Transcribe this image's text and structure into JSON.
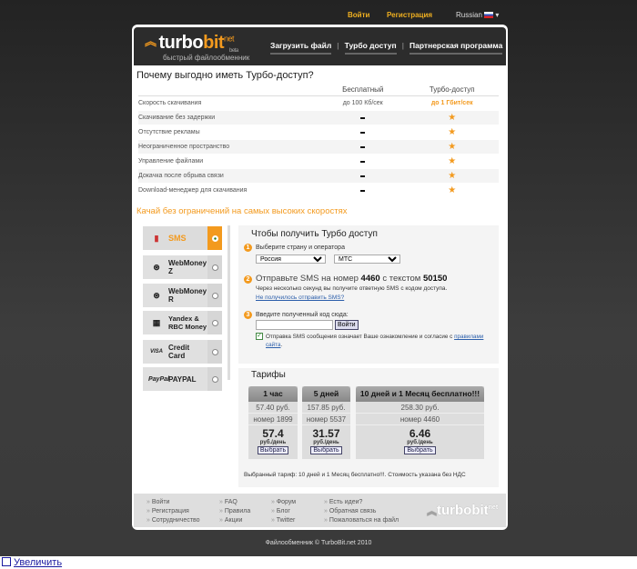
{
  "topbar": {
    "login": "Войти",
    "register": "Регистрация",
    "language": "Russian"
  },
  "header": {
    "logo_turbo": "turbo",
    "logo_bit": "bit",
    "logo_net": "net",
    "logo_beta": "beta",
    "tagline": "быстрый файлообменник",
    "nav": [
      "Загрузить файл",
      "Турбо доступ",
      "Партнерская программа"
    ]
  },
  "compare": {
    "title": "Почему выгодно иметь Турбо-доступ?",
    "col_free": "Бесплатный",
    "col_turbo": "Турбо-доступ",
    "rows": [
      {
        "label": "Скорость скачивания",
        "free": "до 100 Кб/сек",
        "turbo": "до 1 Гбит/сек"
      },
      {
        "label": "Скачивание без задержки"
      },
      {
        "label": "Отсутствие рекламы"
      },
      {
        "label": "Неограниченное пространство"
      },
      {
        "label": "Управление файлами"
      },
      {
        "label": "Докачка после обрыва связи"
      },
      {
        "label": "Download-менеджер для скачивания"
      }
    ]
  },
  "subtitle": "Качай без ограничений на самых высоких скоростях",
  "methods": [
    {
      "label": "SMS",
      "selected": true
    },
    {
      "label": "WebMoney Z"
    },
    {
      "label": "WebMoney R"
    },
    {
      "label": "Yandex & RBC Money"
    },
    {
      "label": "Credit Card"
    },
    {
      "label": "PAYPAL"
    }
  ],
  "sms": {
    "title": "Чтобы получить Турбо доступ",
    "step1": "Выберите страну и оператора",
    "country": "Россия",
    "operator": "МТС",
    "step2_pre": "Отправьте SMS на номер",
    "number": "4460",
    "step2_mid": "с текстом",
    "code": "50150",
    "step2_note": "Через несколько секунд вы получите ответную SMS с кодом доступа.",
    "step2_link": "Не получилось отправить SMS?",
    "step3": "Введите полученный код сюда:",
    "code_value": "",
    "login_button": "Войти",
    "agree_text": "Отправка SMS сообщения означает Ваше ознакомление и согласие с",
    "agree_link": "правилами сайта",
    "agree_end": "."
  },
  "tariffs": {
    "title": "Тарифы",
    "plans": [
      {
        "name": "1 час",
        "price": "57.40 руб.",
        "number": "номер 1899",
        "per_day": "57.4",
        "unit": "руб./день",
        "button": "Выбрать"
      },
      {
        "name": "5 дней",
        "price": "157.85 руб.",
        "number": "номер 5537",
        "per_day": "31.57",
        "unit": "руб./день",
        "button": "Выбрать"
      },
      {
        "name": "10 дней и 1 Месяц бесплатно!!!",
        "price": "258.30 руб.",
        "number": "номер 4460",
        "per_day": "6.46",
        "unit": "руб./день",
        "button": "Выбрать"
      }
    ],
    "selected_note": "Выбранный тариф: 10 дней и 1 Месяц бесплатно!!!. Стоимость указана без НДС"
  },
  "footer": {
    "col1": [
      "Войти",
      "Регистрация",
      "Сотрудничество"
    ],
    "col2": [
      "FAQ",
      "Правила",
      "Акции"
    ],
    "col3": [
      "Форум",
      "Блог",
      "Twitter"
    ],
    "col4": [
      "Есть идеи?",
      "Обратная связь",
      "Пожаловаться на файл"
    ],
    "logo_turbo": "turbo",
    "logo_bit": "bit",
    "logo_net": "net"
  },
  "copyright": "Файлообменник © TurboBit.net 2010",
  "zoom_link": "Увеличить",
  "colors": {
    "accent": "#f39a1e",
    "dark": "#2c2c2c"
  }
}
